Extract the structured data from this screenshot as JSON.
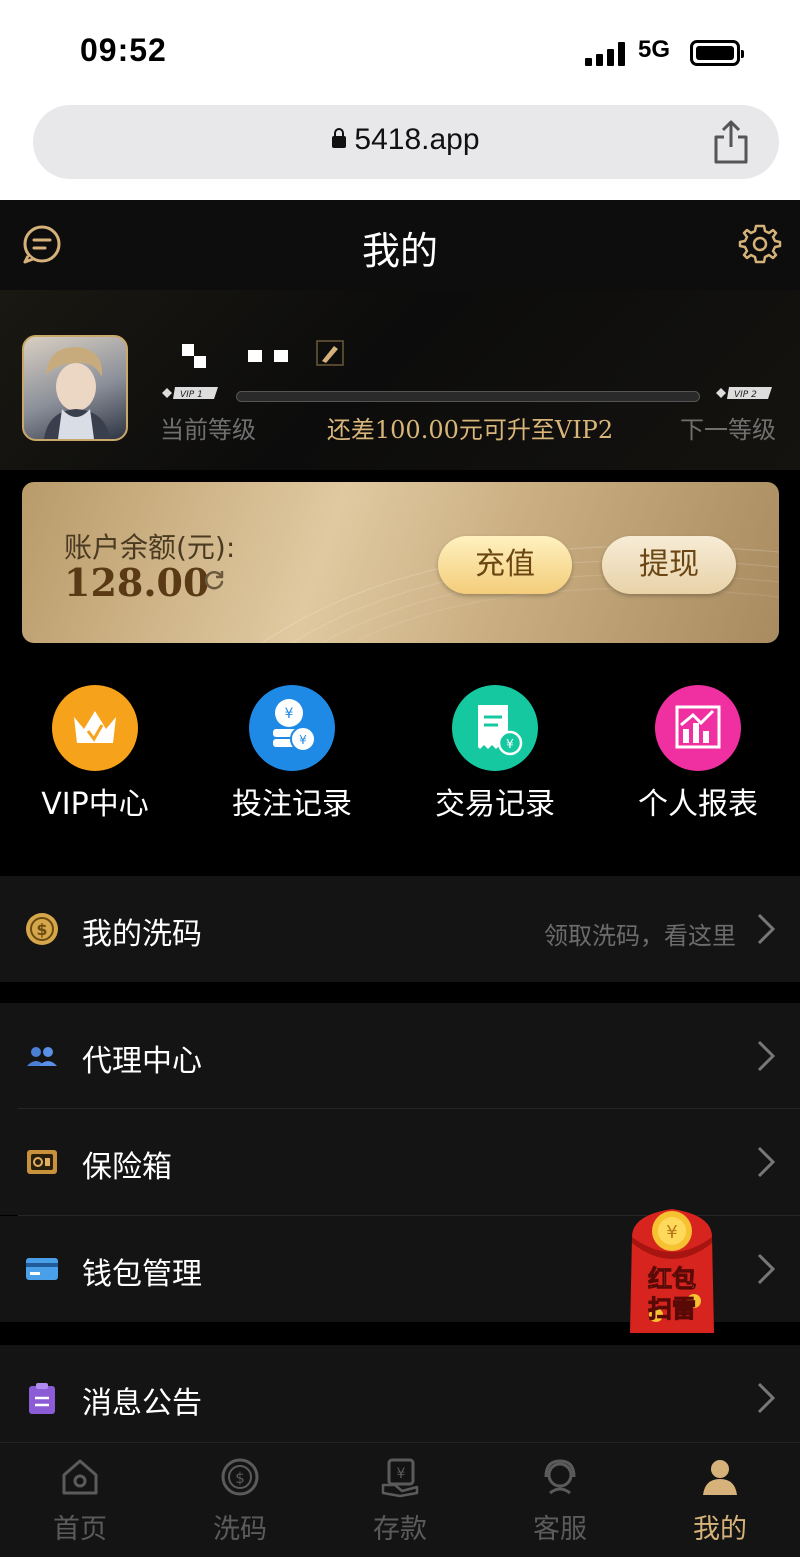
{
  "status_bar": {
    "time": "09:52",
    "network": "5G"
  },
  "browser": {
    "url": "5418.app"
  },
  "header": {
    "title": "我的"
  },
  "profile": {
    "current_vip_tag": "VIP 1",
    "next_vip_tag": "VIP 2",
    "current_level_label": "当前等级",
    "next_level_label": "下一等级",
    "upgrade_text": "还差100.00元可升至VIP2",
    "progress_fraction": 0
  },
  "balance": {
    "label": "账户余额(元):",
    "value": "128.00",
    "recharge_label": "充值",
    "withdraw_label": "提现"
  },
  "quick_links": [
    {
      "label": "VIP中心",
      "icon": "crown-icon",
      "color": "#f7a21b"
    },
    {
      "label": "投注记录",
      "icon": "coins-icon",
      "color": "#1f8ae6"
    },
    {
      "label": "交易记录",
      "icon": "receipt-icon",
      "color": "#15c8a0"
    },
    {
      "label": "个人报表",
      "icon": "chart-icon",
      "color": "#f02fa0"
    }
  ],
  "menu": {
    "wash": {
      "label": "我的洗码",
      "hint": "领取洗码，看这里"
    },
    "agent": {
      "label": "代理中心"
    },
    "safe": {
      "label": "保险箱"
    },
    "wallet": {
      "label": "钱包管理"
    },
    "notice": {
      "label": "消息公告"
    }
  },
  "envelope": {
    "line1": "红包",
    "line2": "扫雷"
  },
  "tabs": [
    {
      "label": "首页",
      "active": false
    },
    {
      "label": "洗码",
      "active": false
    },
    {
      "label": "存款",
      "active": false
    },
    {
      "label": "客服",
      "active": false
    },
    {
      "label": "我的",
      "active": true
    }
  ],
  "colors": {
    "accent_gold": "#d6b27a",
    "background": "#000000",
    "row_bg": "#141414"
  }
}
